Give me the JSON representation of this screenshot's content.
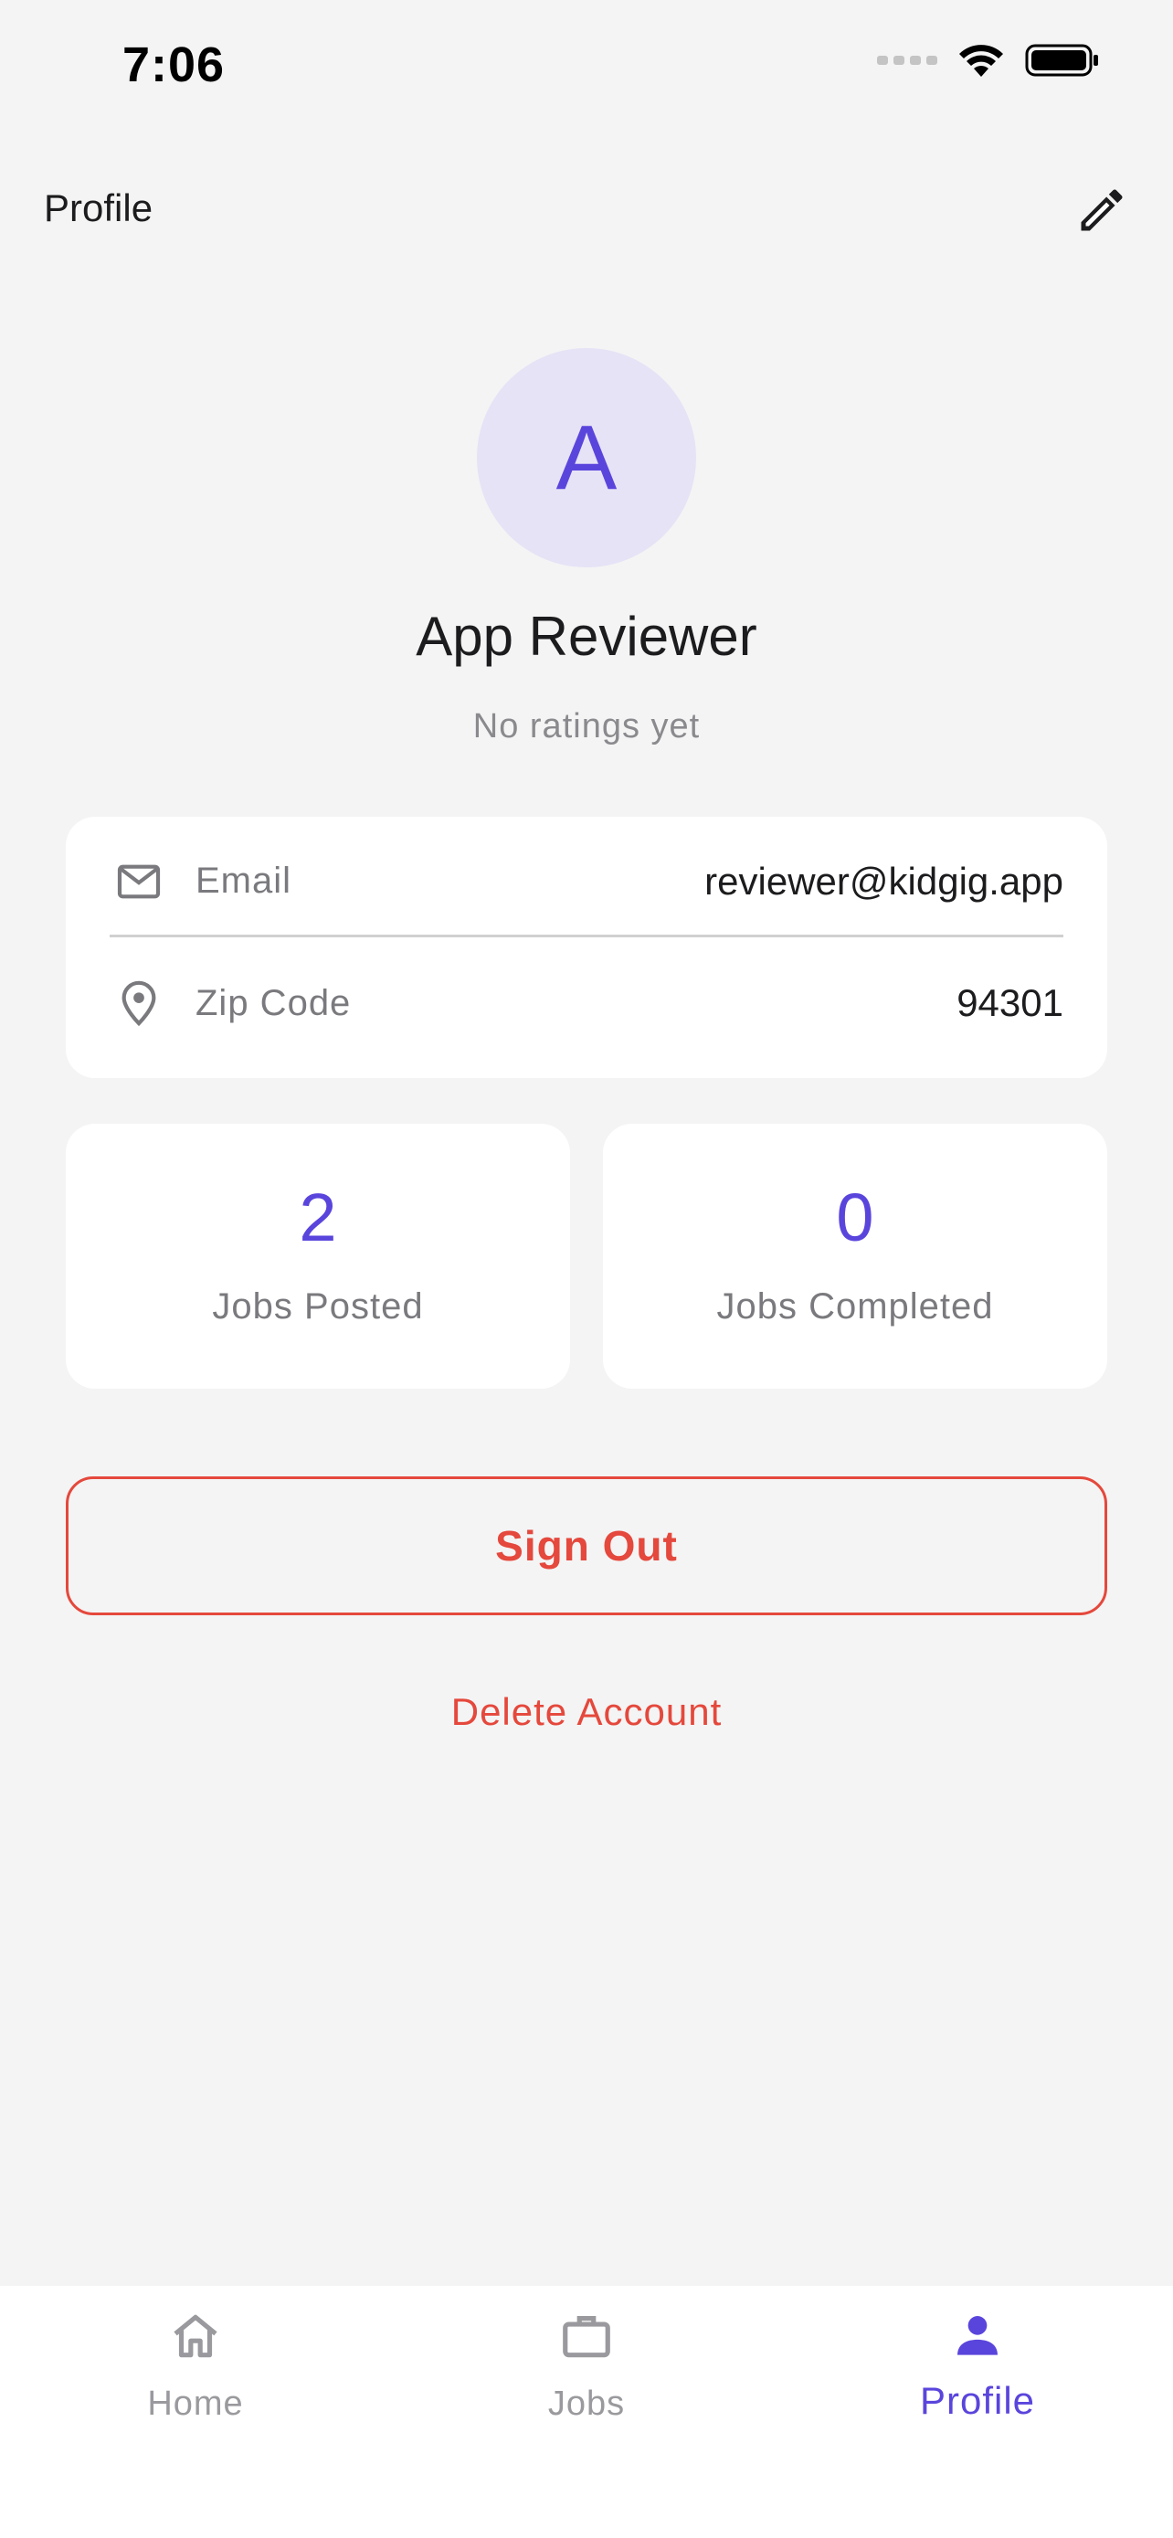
{
  "status_bar": {
    "time": "7:06"
  },
  "header": {
    "title": "Profile"
  },
  "profile": {
    "avatar_initial": "A",
    "name": "App Reviewer",
    "rating_text": "No ratings yet"
  },
  "info": {
    "email_label": "Email",
    "email_value": "reviewer@kidgig.app",
    "zip_label": "Zip Code",
    "zip_value": "94301"
  },
  "stats": {
    "posted_value": "2",
    "posted_label": "Jobs Posted",
    "completed_value": "0",
    "completed_label": "Jobs Completed"
  },
  "actions": {
    "sign_out": "Sign Out",
    "delete_account": "Delete Account"
  },
  "nav": {
    "items": [
      {
        "label": "Home",
        "icon": "home-icon",
        "active": false
      },
      {
        "label": "Jobs",
        "icon": "briefcase-icon",
        "active": false
      },
      {
        "label": "Profile",
        "icon": "person-icon",
        "active": true
      }
    ]
  },
  "colors": {
    "accent": "#5a45dc",
    "danger": "#e5483c",
    "background": "#f4f4f4",
    "avatar_bg": "#e6e3f6"
  }
}
